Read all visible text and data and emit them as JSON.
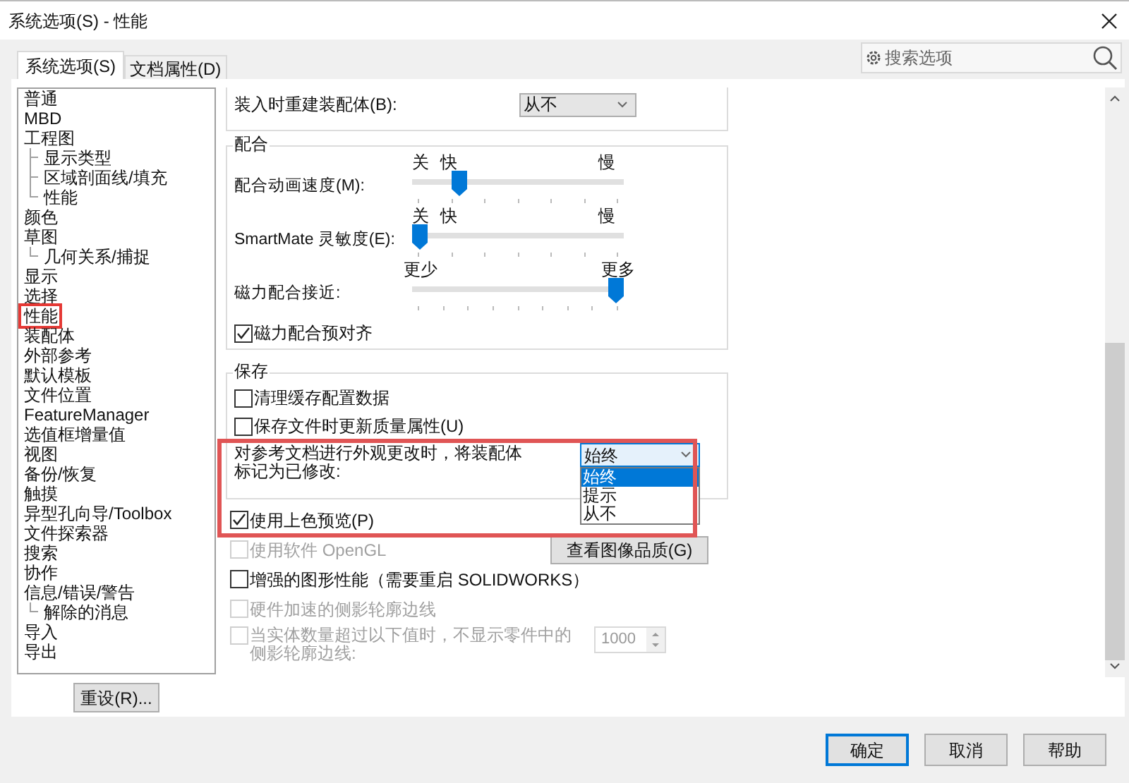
{
  "window": {
    "title": "系统选项(S) - 性能"
  },
  "tabs": [
    {
      "label": "系统选项(S)",
      "selected": true
    },
    {
      "label": "文档属性(D)",
      "selected": false
    }
  ],
  "search": {
    "placeholder": "搜索选项"
  },
  "tree": [
    {
      "label": "普通",
      "highlighted": false
    },
    {
      "label": "MBD",
      "highlighted": false
    },
    {
      "label": "工程图",
      "highlighted": false,
      "children": [
        {
          "label": "显示类型",
          "highlighted": false
        },
        {
          "label": "区域剖面线/填充",
          "highlighted": false
        },
        {
          "label": "性能",
          "highlighted": false
        }
      ]
    },
    {
      "label": "颜色",
      "highlighted": false
    },
    {
      "label": "草图",
      "highlighted": false,
      "children": [
        {
          "label": "几何关系/捕捉",
          "highlighted": false
        }
      ]
    },
    {
      "label": "显示",
      "highlighted": false
    },
    {
      "label": "选择",
      "highlighted": false
    },
    {
      "label": "性能",
      "highlighted": true
    },
    {
      "label": "装配体",
      "highlighted": false
    },
    {
      "label": "外部参考",
      "highlighted": false
    },
    {
      "label": "默认模板",
      "highlighted": false
    },
    {
      "label": "文件位置",
      "highlighted": false
    },
    {
      "label": "FeatureManager",
      "highlighted": false
    },
    {
      "label": "选值框增量值",
      "highlighted": false
    },
    {
      "label": "视图",
      "highlighted": false
    },
    {
      "label": "备份/恢复",
      "highlighted": false
    },
    {
      "label": "触摸",
      "highlighted": false
    },
    {
      "label": "异型孔向导/Toolbox",
      "highlighted": false
    },
    {
      "label": "文件探索器",
      "highlighted": false
    },
    {
      "label": "搜索",
      "highlighted": false
    },
    {
      "label": "协作",
      "highlighted": false
    },
    {
      "label": "信息/错误/警告",
      "highlighted": false,
      "children": [
        {
          "label": "解除的消息",
          "highlighted": false
        }
      ]
    },
    {
      "label": "导入",
      "highlighted": false
    },
    {
      "label": "导出",
      "highlighted": false
    }
  ],
  "reset_button": "重设(R)...",
  "sections": [
    {
      "kind": "partial_group",
      "items": [
        {
          "kind": "dropdown",
          "label": "装入时重建装配体(B):",
          "value": "从不",
          "expanded": false,
          "highlighted": false
        }
      ]
    },
    {
      "kind": "group",
      "title": "配合",
      "items": [
        {
          "kind": "slider",
          "label": "配合动画速度(M):",
          "marks": [
            "关",
            "快",
            "慢"
          ],
          "level": 0.2
        },
        {
          "kind": "slider",
          "label": "SmartMate 灵敏度(E):",
          "marks": [
            "关",
            "快",
            "慢"
          ],
          "level": 0
        },
        {
          "kind": "slider",
          "label": "磁力配合接近:",
          "marks": [
            "更少",
            "更多"
          ],
          "level": 1
        },
        {
          "kind": "checkbox",
          "label": "磁力配合预对齐",
          "checked": true,
          "disabled": false
        }
      ]
    },
    {
      "kind": "group",
      "title": "保存",
      "items": [
        {
          "kind": "checkbox",
          "label": "清理缓存配置数据",
          "checked": false,
          "disabled": false
        },
        {
          "kind": "checkbox",
          "label": "保存文件时更新质量属性(U)",
          "checked": false,
          "disabled": false
        },
        {
          "kind": "dropdown",
          "label": "对参考文档进行外观更改时，将装配体标记为已修改:",
          "value": "始终",
          "expanded": true,
          "highlighted": true,
          "options": [
            {
              "label": "始终",
              "selected": true
            },
            {
              "label": "提示",
              "selected": false
            },
            {
              "label": "从不",
              "selected": false
            }
          ]
        }
      ]
    },
    {
      "kind": "plain",
      "items": [
        {
          "kind": "checkbox",
          "label": "使用上色预览(P)",
          "checked": true,
          "disabled": false
        },
        {
          "kind": "checkbox",
          "label": "使用软件 OpenGL",
          "checked": false,
          "disabled": true,
          "button": "查看图像品质(G)"
        },
        {
          "kind": "checkbox",
          "label": "增强的图形性能（需要重启 SOLIDWORKS）",
          "checked": false,
          "disabled": false
        },
        {
          "kind": "checkbox",
          "label": "硬件加速的侧影轮廓边线",
          "checked": false,
          "disabled": true
        },
        {
          "kind": "spinner",
          "label": "当实体数量超过以下值时，不显示零件中的侧影轮廓边线:",
          "checked": false,
          "disabled": true,
          "value": "1000"
        }
      ]
    }
  ],
  "buttons": [
    {
      "label": "确定",
      "default": true
    },
    {
      "label": "取消",
      "default": false
    },
    {
      "label": "帮助",
      "default": false
    }
  ]
}
